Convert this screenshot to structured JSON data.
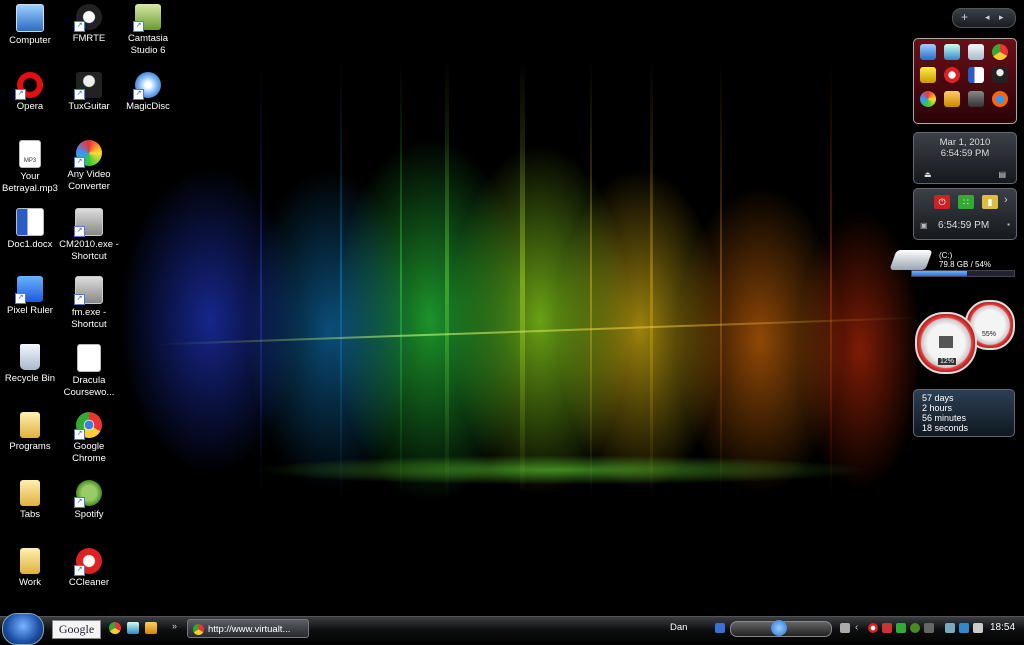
{
  "desktop": {
    "icons": [
      {
        "label": "Computer",
        "icon": "computer-icon"
      },
      {
        "label": "FMRTE",
        "icon": "fmrte-icon"
      },
      {
        "label": "Camtasia Studio 6",
        "icon": "camtasia-icon"
      },
      {
        "label": "Opera",
        "icon": "opera-icon"
      },
      {
        "label": "TuxGuitar",
        "icon": "tuxguitar-icon"
      },
      {
        "label": "MagicDisc",
        "icon": "magicdisc-icon"
      },
      {
        "label": "Your Betrayal.mp3",
        "icon": "mp3-file-icon"
      },
      {
        "label": "Any Video Converter",
        "icon": "video-converter-icon"
      },
      {
        "label": "Doc1.docx",
        "icon": "word-document-icon"
      },
      {
        "label": "CM2010.exe - Shortcut",
        "icon": "exe-shortcut-icon"
      },
      {
        "label": "Pixel Ruler",
        "icon": "pixel-ruler-icon"
      },
      {
        "label": "fm.exe - Shortcut",
        "icon": "exe-shortcut-icon"
      },
      {
        "label": "Recycle Bin",
        "icon": "recycle-bin-icon"
      },
      {
        "label": "Dracula Coursewo...",
        "icon": "document-icon"
      },
      {
        "label": "Programs",
        "icon": "folder-icon"
      },
      {
        "label": "Google Chrome",
        "icon": "chrome-icon"
      },
      {
        "label": "Tabs",
        "icon": "folder-icon"
      },
      {
        "label": "Spotify",
        "icon": "spotify-icon"
      },
      {
        "label": "Work",
        "icon": "folder-icon"
      },
      {
        "label": "CCleaner",
        "icon": "ccleaner-icon"
      }
    ]
  },
  "sidebar": {
    "top_controls": {
      "add": "+",
      "prev": "◂",
      "next": "▸"
    },
    "clock_gadget": {
      "date": "Mar 1, 2010",
      "time": "6:54:59 PM"
    },
    "power_gadget": {
      "time": "6:54:59 PM",
      "more": "›"
    },
    "drive_gadget": {
      "drive": "(C:)",
      "usage": "79.8 GB / 54%",
      "fill_percent": 54
    },
    "meters_gadget": {
      "cpu": "12%",
      "memory": "55%"
    },
    "uptime_gadget": {
      "days": "57 days",
      "hours": "2 hours",
      "minutes": "56 minutes",
      "seconds": "18 seconds"
    }
  },
  "taskbar": {
    "search_box": "Google",
    "overflow": "»",
    "task_button": "http://www.virtualt...",
    "deskband_user": "Dan",
    "clock": "18:54"
  },
  "colors": {
    "launcher_bg": "#6a0f18",
    "drive_fill": "#2a6fd6",
    "taskbar_bg": "#0d0e10"
  }
}
